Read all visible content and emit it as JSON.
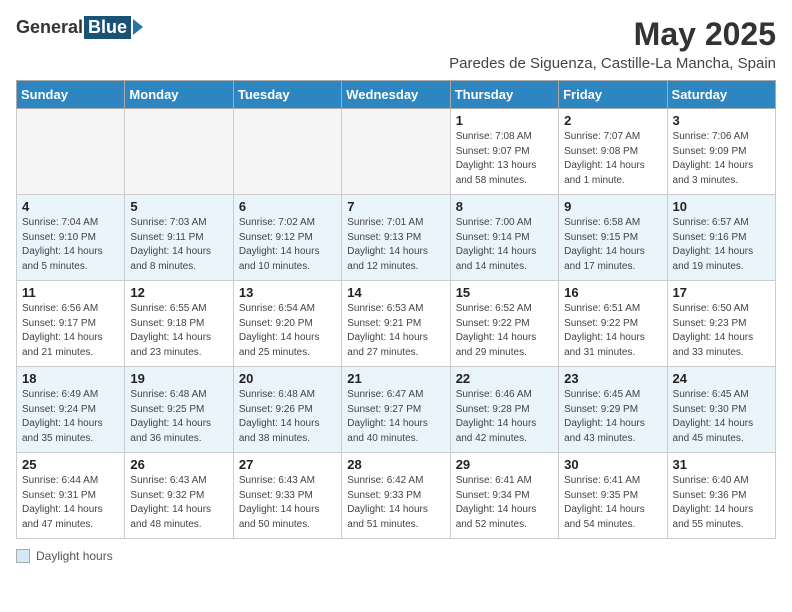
{
  "header": {
    "logo_general": "General",
    "logo_blue": "Blue",
    "title": "May 2025",
    "subtitle": "Paredes de Siguenza, Castille-La Mancha, Spain"
  },
  "calendar": {
    "days_of_week": [
      "Sunday",
      "Monday",
      "Tuesday",
      "Wednesday",
      "Thursday",
      "Friday",
      "Saturday"
    ],
    "weeks": [
      [
        {
          "day": "",
          "info": ""
        },
        {
          "day": "",
          "info": ""
        },
        {
          "day": "",
          "info": ""
        },
        {
          "day": "",
          "info": ""
        },
        {
          "day": "1",
          "info": "Sunrise: 7:08 AM\nSunset: 9:07 PM\nDaylight: 13 hours\nand 58 minutes."
        },
        {
          "day": "2",
          "info": "Sunrise: 7:07 AM\nSunset: 9:08 PM\nDaylight: 14 hours\nand 1 minute."
        },
        {
          "day": "3",
          "info": "Sunrise: 7:06 AM\nSunset: 9:09 PM\nDaylight: 14 hours\nand 3 minutes."
        }
      ],
      [
        {
          "day": "4",
          "info": "Sunrise: 7:04 AM\nSunset: 9:10 PM\nDaylight: 14 hours\nand 5 minutes."
        },
        {
          "day": "5",
          "info": "Sunrise: 7:03 AM\nSunset: 9:11 PM\nDaylight: 14 hours\nand 8 minutes."
        },
        {
          "day": "6",
          "info": "Sunrise: 7:02 AM\nSunset: 9:12 PM\nDaylight: 14 hours\nand 10 minutes."
        },
        {
          "day": "7",
          "info": "Sunrise: 7:01 AM\nSunset: 9:13 PM\nDaylight: 14 hours\nand 12 minutes."
        },
        {
          "day": "8",
          "info": "Sunrise: 7:00 AM\nSunset: 9:14 PM\nDaylight: 14 hours\nand 14 minutes."
        },
        {
          "day": "9",
          "info": "Sunrise: 6:58 AM\nSunset: 9:15 PM\nDaylight: 14 hours\nand 17 minutes."
        },
        {
          "day": "10",
          "info": "Sunrise: 6:57 AM\nSunset: 9:16 PM\nDaylight: 14 hours\nand 19 minutes."
        }
      ],
      [
        {
          "day": "11",
          "info": "Sunrise: 6:56 AM\nSunset: 9:17 PM\nDaylight: 14 hours\nand 21 minutes."
        },
        {
          "day": "12",
          "info": "Sunrise: 6:55 AM\nSunset: 9:18 PM\nDaylight: 14 hours\nand 23 minutes."
        },
        {
          "day": "13",
          "info": "Sunrise: 6:54 AM\nSunset: 9:20 PM\nDaylight: 14 hours\nand 25 minutes."
        },
        {
          "day": "14",
          "info": "Sunrise: 6:53 AM\nSunset: 9:21 PM\nDaylight: 14 hours\nand 27 minutes."
        },
        {
          "day": "15",
          "info": "Sunrise: 6:52 AM\nSunset: 9:22 PM\nDaylight: 14 hours\nand 29 minutes."
        },
        {
          "day": "16",
          "info": "Sunrise: 6:51 AM\nSunset: 9:22 PM\nDaylight: 14 hours\nand 31 minutes."
        },
        {
          "day": "17",
          "info": "Sunrise: 6:50 AM\nSunset: 9:23 PM\nDaylight: 14 hours\nand 33 minutes."
        }
      ],
      [
        {
          "day": "18",
          "info": "Sunrise: 6:49 AM\nSunset: 9:24 PM\nDaylight: 14 hours\nand 35 minutes."
        },
        {
          "day": "19",
          "info": "Sunrise: 6:48 AM\nSunset: 9:25 PM\nDaylight: 14 hours\nand 36 minutes."
        },
        {
          "day": "20",
          "info": "Sunrise: 6:48 AM\nSunset: 9:26 PM\nDaylight: 14 hours\nand 38 minutes."
        },
        {
          "day": "21",
          "info": "Sunrise: 6:47 AM\nSunset: 9:27 PM\nDaylight: 14 hours\nand 40 minutes."
        },
        {
          "day": "22",
          "info": "Sunrise: 6:46 AM\nSunset: 9:28 PM\nDaylight: 14 hours\nand 42 minutes."
        },
        {
          "day": "23",
          "info": "Sunrise: 6:45 AM\nSunset: 9:29 PM\nDaylight: 14 hours\nand 43 minutes."
        },
        {
          "day": "24",
          "info": "Sunrise: 6:45 AM\nSunset: 9:30 PM\nDaylight: 14 hours\nand 45 minutes."
        }
      ],
      [
        {
          "day": "25",
          "info": "Sunrise: 6:44 AM\nSunset: 9:31 PM\nDaylight: 14 hours\nand 47 minutes."
        },
        {
          "day": "26",
          "info": "Sunrise: 6:43 AM\nSunset: 9:32 PM\nDaylight: 14 hours\nand 48 minutes."
        },
        {
          "day": "27",
          "info": "Sunrise: 6:43 AM\nSunset: 9:33 PM\nDaylight: 14 hours\nand 50 minutes."
        },
        {
          "day": "28",
          "info": "Sunrise: 6:42 AM\nSunset: 9:33 PM\nDaylight: 14 hours\nand 51 minutes."
        },
        {
          "day": "29",
          "info": "Sunrise: 6:41 AM\nSunset: 9:34 PM\nDaylight: 14 hours\nand 52 minutes."
        },
        {
          "day": "30",
          "info": "Sunrise: 6:41 AM\nSunset: 9:35 PM\nDaylight: 14 hours\nand 54 minutes."
        },
        {
          "day": "31",
          "info": "Sunrise: 6:40 AM\nSunset: 9:36 PM\nDaylight: 14 hours\nand 55 minutes."
        }
      ]
    ]
  },
  "footer": {
    "label": "Daylight hours"
  }
}
